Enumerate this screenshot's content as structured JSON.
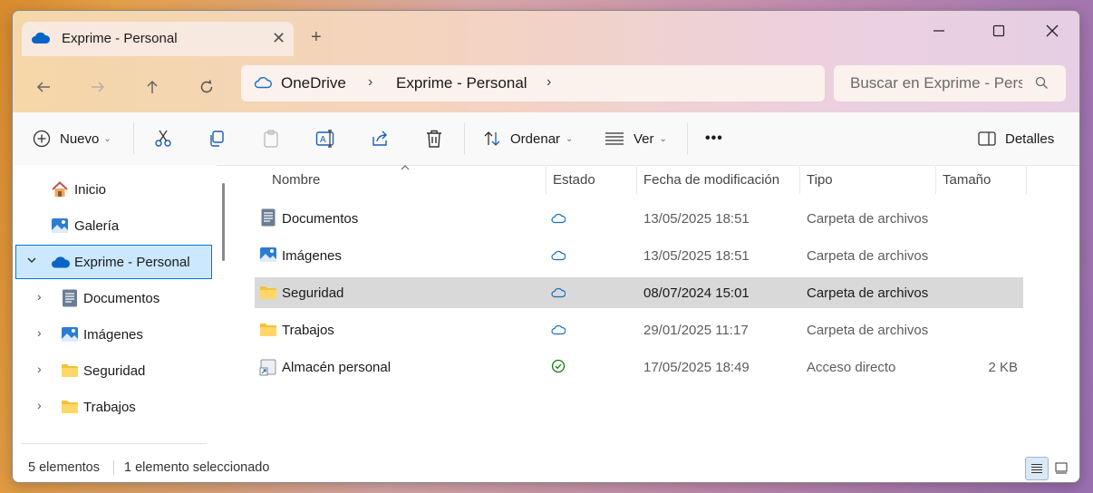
{
  "window": {
    "tab_title": "Exprime - Personal",
    "new_tab_label": "+"
  },
  "address": {
    "crumbs": [
      "OneDrive",
      "Exprime - Personal"
    ],
    "search_placeholder": "Buscar en Exprime - Personal"
  },
  "toolbar": {
    "new_label": "Nuevo",
    "sort_label": "Ordenar",
    "view_label": "Ver",
    "more_label": "•••",
    "details_label": "Detalles"
  },
  "sidebar": {
    "items": [
      {
        "label": "Inicio",
        "icon": "home-icon"
      },
      {
        "label": "Galería",
        "icon": "gallery-icon"
      },
      {
        "label": "Exprime - Personal",
        "icon": "onedrive-cloud-icon",
        "expanded": true,
        "selected": true
      },
      {
        "label": "Documentos",
        "icon": "documents-icon"
      },
      {
        "label": "Imágenes",
        "icon": "pictures-icon"
      },
      {
        "label": "Seguridad",
        "icon": "folder-icon"
      },
      {
        "label": "Trabajos",
        "icon": "folder-icon"
      }
    ]
  },
  "columns": {
    "name": "Nombre",
    "status": "Estado",
    "modified": "Fecha de modificación",
    "type": "Tipo",
    "size": "Tamaño"
  },
  "files": [
    {
      "name": "Documentos",
      "icon": "documents-icon",
      "status": "cloud",
      "modified": "13/05/2025 18:51",
      "type": "Carpeta de archivos",
      "size": ""
    },
    {
      "name": "Imágenes",
      "icon": "pictures-icon",
      "status": "cloud",
      "modified": "13/05/2025 18:51",
      "type": "Carpeta de archivos",
      "size": ""
    },
    {
      "name": "Seguridad",
      "icon": "folder-icon",
      "status": "cloud",
      "modified": "08/07/2024 15:01",
      "type": "Carpeta de archivos",
      "size": "",
      "selected": true
    },
    {
      "name": "Trabajos",
      "icon": "folder-icon",
      "status": "cloud",
      "modified": "29/01/2025 11:17",
      "type": "Carpeta de archivos",
      "size": ""
    },
    {
      "name": "Almacén personal",
      "icon": "shortcut-icon",
      "status": "synced",
      "modified": "17/05/2025 18:49",
      "type": "Acceso directo",
      "size": "2 KB"
    }
  ],
  "status": {
    "count": "5 elementos",
    "selection": "1 elemento seleccionado"
  },
  "colors": {
    "accent": "#0078d4",
    "selected_row": "#d9d9d9",
    "synced_green": "#0f7b0f"
  }
}
